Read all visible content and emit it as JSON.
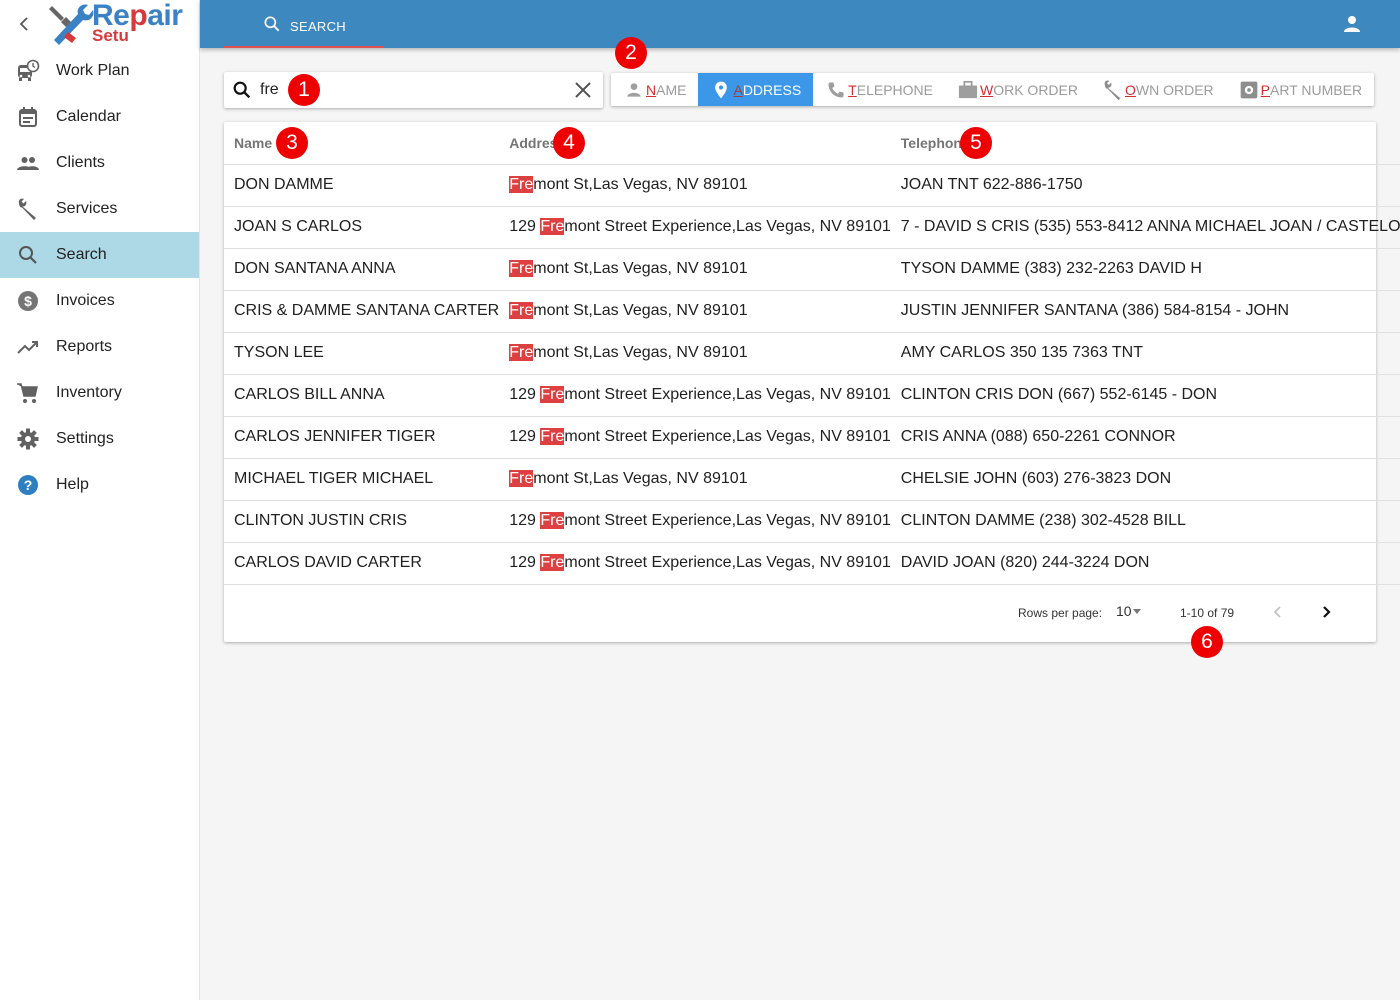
{
  "app": {
    "logo_text_main_a": "Re",
    "logo_text_main_b": "p",
    "logo_text_main_c": "air",
    "logo_text_sub": "Setu"
  },
  "sidebar": {
    "items": [
      {
        "label": "Work Plan",
        "icon": "truck-clock-icon"
      },
      {
        "label": "Calendar",
        "icon": "calendar-icon"
      },
      {
        "label": "Clients",
        "icon": "people-icon"
      },
      {
        "label": "Services",
        "icon": "wrench-icon"
      },
      {
        "label": "Search",
        "icon": "search-icon",
        "active": true
      },
      {
        "label": "Invoices",
        "icon": "dollar-circle-icon"
      },
      {
        "label": "Reports",
        "icon": "trending-up-icon"
      },
      {
        "label": "Inventory",
        "icon": "cart-icon"
      },
      {
        "label": "Settings",
        "icon": "gear-icon"
      },
      {
        "label": "Help",
        "icon": "help-circle-icon"
      }
    ]
  },
  "topbar": {
    "tab_label": "SEARCH"
  },
  "search": {
    "value": "fre",
    "placeholder": ""
  },
  "filters": [
    {
      "accel": "N",
      "rest": "AME",
      "icon": "person-icon",
      "active": false
    },
    {
      "accel": "A",
      "rest": "DDRESS",
      "icon": "location-pin-icon",
      "active": true
    },
    {
      "accel": "T",
      "rest": "ELEPHONE",
      "icon": "phone-icon",
      "active": false
    },
    {
      "accel": "W",
      "rest": "ORK ORDER",
      "icon": "briefcase-icon",
      "active": false
    },
    {
      "accel": "O",
      "rest": "WN ORDER",
      "icon": "wrench-icon",
      "active": false
    },
    {
      "accel": "P",
      "rest": "ART NUMBER",
      "icon": "part-gear-icon",
      "active": false
    }
  ],
  "table": {
    "headers": {
      "name": "Name",
      "address": "Address",
      "telephone": "Telephone"
    },
    "highlight_color": "#dc4040",
    "rows": [
      {
        "name": "DON DAMME",
        "addr_pre": "",
        "addr_hl": "Fre",
        "addr_post": "mont St,Las Vegas, NV 89101",
        "telephone": "JOAN TNT 622-886-1750"
      },
      {
        "name": "JOAN S CARLOS",
        "addr_pre": "129 ",
        "addr_hl": "Fre",
        "addr_post": "mont Street Experience,Las Vegas, NV 89101",
        "telephone": "7 - DAVID S CRIS (535) 553-8412 ANNA MICHAEL JOAN / CASTELO"
      },
      {
        "name": "DON SANTANA ANNA",
        "addr_pre": "",
        "addr_hl": "Fre",
        "addr_post": "mont St,Las Vegas, NV 89101",
        "telephone": "TYSON DAMME (383) 232-2263 DAVID H"
      },
      {
        "name": "CRIS & DAMME SANTANA CARTER",
        "addr_pre": "",
        "addr_hl": "Fre",
        "addr_post": "mont St,Las Vegas, NV 89101",
        "telephone": "JUSTIN JENNIFER SANTANA (386) 584-8154 - JOHN"
      },
      {
        "name": "TYSON LEE",
        "addr_pre": "",
        "addr_hl": "Fre",
        "addr_post": "mont St,Las Vegas, NV 89101",
        "telephone": "AMY CARLOS 350 135 7363 TNT"
      },
      {
        "name": "CARLOS BILL ANNA",
        "addr_pre": "129 ",
        "addr_hl": "Fre",
        "addr_post": "mont Street Experience,Las Vegas, NV 89101",
        "telephone": "CLINTON CRIS DON (667) 552-6145 - DON"
      },
      {
        "name": "CARLOS JENNIFER TIGER",
        "addr_pre": "129 ",
        "addr_hl": "Fre",
        "addr_post": "mont Street Experience,Las Vegas, NV 89101",
        "telephone": "CRIS ANNA (088) 650-2261 CONNOR"
      },
      {
        "name": "MICHAEL TIGER MICHAEL",
        "addr_pre": "",
        "addr_hl": "Fre",
        "addr_post": "mont St,Las Vegas, NV 89101",
        "telephone": "CHELSIE JOHN (603) 276-3823 DON"
      },
      {
        "name": "CLINTON JUSTIN CRIS",
        "addr_pre": "129 ",
        "addr_hl": "Fre",
        "addr_post": "mont Street Experience,Las Vegas, NV 89101",
        "telephone": "CLINTON DAMME (238) 302-4528 BILL"
      },
      {
        "name": "CARLOS DAVID CARTER",
        "addr_pre": "129 ",
        "addr_hl": "Fre",
        "addr_post": "mont Street Experience,Las Vegas, NV 89101",
        "telephone": "DAVID JOAN (820) 244-3224 DON"
      }
    ]
  },
  "pagination": {
    "rows_per_page_label": "Rows per page:",
    "rows_per_page": "10",
    "range": "1-10 of 79"
  },
  "annotations": [
    "1",
    "2",
    "3",
    "4",
    "5",
    "6"
  ],
  "colors": {
    "topbar": "#3e88c0",
    "active_nav": "#add8e6",
    "active_filter": "#3d97e8",
    "badge": "#ee0000",
    "tab_underline": "#e05050"
  }
}
